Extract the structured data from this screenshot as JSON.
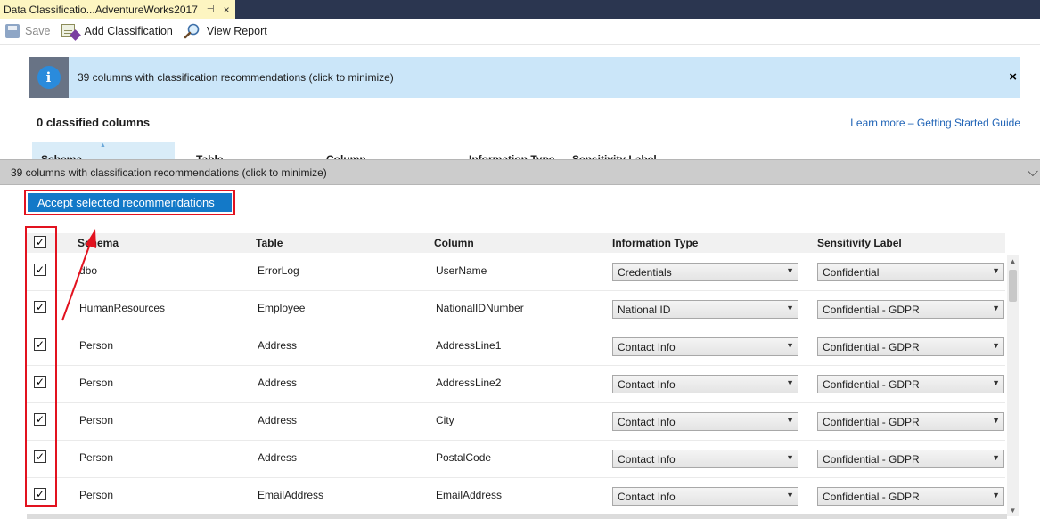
{
  "doc_tab": {
    "title": "Data Classificatio...AdventureWorks2017",
    "pin_glyph": "⊣",
    "close_glyph": "×"
  },
  "toolbar": {
    "save_label": "Save",
    "add_classification_label": "Add Classification",
    "view_report_label": "View Report"
  },
  "banner": {
    "text": "39 columns with classification recommendations (click to minimize)",
    "close_glyph": "×",
    "info_glyph": "i"
  },
  "summary": {
    "classified_text": "0 classified columns",
    "learn_more_text": "Learn more – Getting Started Guide"
  },
  "background_headers": [
    "Schema",
    "Table",
    "Column",
    "Information Type",
    "Sensitivity Label"
  ],
  "recommendations": {
    "bar_text": "39 columns with classification recommendations (click to minimize)",
    "chevron_glyph": "⌵",
    "accept_label": "Accept selected recommendations",
    "headers": {
      "schema": "Schema",
      "table": "Table",
      "column": "Column",
      "info_type": "Information Type",
      "sensitivity": "Sensitivity Label"
    },
    "rows": [
      {
        "schema": "dbo",
        "table": "ErrorLog",
        "column": "UserName",
        "info_type": "Credentials",
        "sensitivity": "Confidential",
        "checked": true
      },
      {
        "schema": "HumanResources",
        "table": "Employee",
        "column": "NationalIDNumber",
        "info_type": "National ID",
        "sensitivity": "Confidential - GDPR",
        "checked": true
      },
      {
        "schema": "Person",
        "table": "Address",
        "column": "AddressLine1",
        "info_type": "Contact Info",
        "sensitivity": "Confidential - GDPR",
        "checked": true
      },
      {
        "schema": "Person",
        "table": "Address",
        "column": "AddressLine2",
        "info_type": "Contact Info",
        "sensitivity": "Confidential - GDPR",
        "checked": true
      },
      {
        "schema": "Person",
        "table": "Address",
        "column": "City",
        "info_type": "Contact Info",
        "sensitivity": "Confidential - GDPR",
        "checked": true
      },
      {
        "schema": "Person",
        "table": "Address",
        "column": "PostalCode",
        "info_type": "Contact Info",
        "sensitivity": "Confidential - GDPR",
        "checked": true
      },
      {
        "schema": "Person",
        "table": "EmailAddress",
        "column": "EmailAddress",
        "info_type": "Contact Info",
        "sensitivity": "Confidential - GDPR",
        "checked": true
      }
    ]
  },
  "glyphs": {
    "check": "✓",
    "dropdown": "▼",
    "sort_up": "▲",
    "scroll_up": "▲",
    "scroll_down": "▼"
  },
  "colors": {
    "accent": "#1379c8",
    "highlight_red": "#e2121f",
    "banner_bg": "#cbe6f9",
    "title_bar": "#2b3650"
  }
}
